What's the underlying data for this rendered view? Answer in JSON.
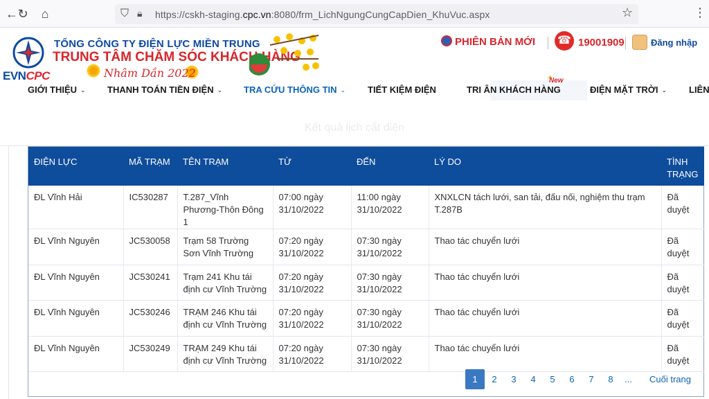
{
  "browser": {
    "url_prefix": "https://cskh-staging.",
    "url_domain": "cpc.vn",
    "url_suffix": ":8080/frm_LichNgungCungCapDien_KhuVuc.aspx"
  },
  "header": {
    "logo_evn": "EVN",
    "logo_cpc": "CPC",
    "company_name": "TỔNG CÔNG TY ĐIỆN LỰC MIỀN TRUNG",
    "center_name": "TRUNG TÂM CHĂM SÓC KHÁCH HÀNG",
    "year_text": "Nhâm Dần 2022",
    "new_version": "PHIÊN BẢN MỚI",
    "hotline": "19001909",
    "login": "Đăng nhập"
  },
  "menu": {
    "items": [
      {
        "label": "GIỚI THIỆU"
      },
      {
        "label": "THANH TOÁN TIỀN ĐIỆN"
      },
      {
        "label": "TRA CỨU THÔNG TIN"
      },
      {
        "label": "TIẾT KIỆM ĐIỆN"
      },
      {
        "label": "TRI ÂN KHÁCH HÀNG"
      },
      {
        "label": "ĐIỆN MẶT TRỜI"
      },
      {
        "label": "LIÊN"
      }
    ],
    "new_badge": "New"
  },
  "content": {
    "section_title": "Kết quả lịch cắt điện",
    "columns": [
      "ĐIỆN LỰC",
      "MÃ TRẠM",
      "TÊN TRẠM",
      "TỪ",
      "ĐẾN",
      "LÝ DO",
      "TÌNH TRẠNG"
    ],
    "rows": [
      {
        "dien_luc": "ĐL Vĩnh Hải",
        "ma_tram": "IC530287",
        "ten_tram": "T.287_Vĩnh Phương-Thôn Đông 1",
        "tu": "07:00 ngày 31/10/2022",
        "den": "11:00 ngày 31/10/2022",
        "ly_do": "XNXLCN tách lưới, san tải, đấu nối, nghiệm thu trạm T.287B",
        "tinh_trang": "Đã duyệt"
      },
      {
        "dien_luc": "ĐL Vĩnh Nguyên",
        "ma_tram": "JC530058",
        "ten_tram": "Trạm 58 Trường Sơn Vĩnh Trường",
        "tu": "07:20 ngày 31/10/2022",
        "den": "07:30 ngày 31/10/2022",
        "ly_do": "Thao tác chuyển lưới",
        "tinh_trang": "Đã duyệt"
      },
      {
        "dien_luc": "ĐL Vĩnh Nguyên",
        "ma_tram": "JC530241",
        "ten_tram": "Trạm 241 Khu tái định cư Vĩnh Trường",
        "tu": "07:20 ngày 31/10/2022",
        "den": "07:30 ngày 31/10/2022",
        "ly_do": "Thao tác chuyển lưới",
        "tinh_trang": "Đã duyệt"
      },
      {
        "dien_luc": "ĐL Vĩnh Nguyên",
        "ma_tram": "JC530246",
        "ten_tram": "TRẠM 246 Khu tái định cư Vĩnh Trường",
        "tu": "07:20 ngày 31/10/2022",
        "den": "07:30 ngày 31/10/2022",
        "ly_do": "Thao tác chuyển lưới",
        "tinh_trang": "Đã duyệt"
      },
      {
        "dien_luc": "ĐL Vĩnh Nguyên",
        "ma_tram": "JC530249",
        "ten_tram": "TRẠM 249 Khu tái định cư Vĩnh Trường",
        "tu": "07:20 ngày 31/10/2022",
        "den": "07:30 ngày 31/10/2022",
        "ly_do": "Thao tác chuyển lưới",
        "tinh_trang": "Đã duyệt"
      }
    ]
  },
  "pagination": {
    "pages": [
      "1",
      "2",
      "3",
      "4",
      "5",
      "6",
      "7",
      "8"
    ],
    "current": "1",
    "dots": "...",
    "last": "Cuối trang"
  },
  "colors": {
    "brand_blue": "#0e4c9c",
    "brand_red": "#d8262c",
    "link_blue": "#0e62b8"
  }
}
